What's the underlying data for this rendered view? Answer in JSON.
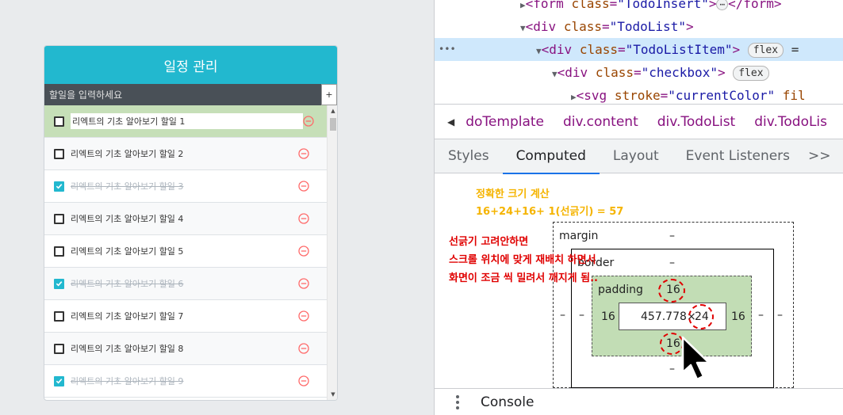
{
  "app": {
    "title": "일정 관리",
    "input_placeholder": "할일을 입력하세요",
    "add_label": "+",
    "todos": [
      {
        "text": "리엑트의 기초 알아보기 할일 1",
        "checked": false
      },
      {
        "text": "리엑트의 기초 알아보기 할일 2",
        "checked": false
      },
      {
        "text": "리엑트의 기초 알아보기 할일 3",
        "checked": true
      },
      {
        "text": "리엑트의 기초 알아보기 할일 4",
        "checked": false
      },
      {
        "text": "리엑트의 기초 알아보기 할일 5",
        "checked": false
      },
      {
        "text": "리엑트의 기초 알아보기 할일 6",
        "checked": true
      },
      {
        "text": "리엑트의 기초 알아보기 할일 7",
        "checked": false
      },
      {
        "text": "리엑트의 기초 알아보기 할일 8",
        "checked": false
      },
      {
        "text": "리엑트의 기초 알아보기 할일 9",
        "checked": true
      }
    ],
    "accent": "#22b8cf",
    "remove_color": "#ff6b6b"
  },
  "devtools": {
    "dom": {
      "line1": {
        "open": "<",
        "tag": "form",
        "attr": "class",
        "val": "\"TodoInsert\"",
        "close": "</form>"
      },
      "line2": {
        "tag": "div",
        "attr": "class",
        "val": "\"TodoList\""
      },
      "line3": {
        "tag": "div",
        "attr": "class",
        "val": "\"TodoListItem\"",
        "pill": "flex",
        "tail": "="
      },
      "line4": {
        "tag": "div",
        "attr": "class",
        "val": "\"checkbox\"",
        "pill": "flex"
      },
      "line5": {
        "tag": "svg",
        "attr": "stroke",
        "val": "\"currentColor\"",
        "tail": "fil"
      },
      "ellipsis": "⋯"
    },
    "breadcrumbs": [
      "doTemplate",
      "div.content",
      "div.TodoList",
      "div.TodoLis"
    ],
    "tabs": [
      "Styles",
      "Computed",
      "Layout",
      "Event Listeners",
      ">>"
    ],
    "active_tab": "Computed",
    "notes": {
      "yellow_line1": "정확한 크기 계산",
      "yellow_line2": "16+24+16+ 1(선긁기) = 57",
      "red_line1": "선긁기 고려안하면",
      "red_line2": "스크롤 위치에 맞게 재배치 하면서",
      "red_line3": "화면이 조금 씩 밀려서 깨지게 됨.."
    },
    "boxmodel": {
      "margin_label": "margin",
      "border_label": "border",
      "padding_label": "padding",
      "dash": "–",
      "padding_top": "16",
      "padding_left": "16",
      "padding_right": "16",
      "padding_bottom": "16",
      "content_width": "457.778",
      "content_sep": "×",
      "content_height": "24"
    },
    "console_label": "Console"
  }
}
